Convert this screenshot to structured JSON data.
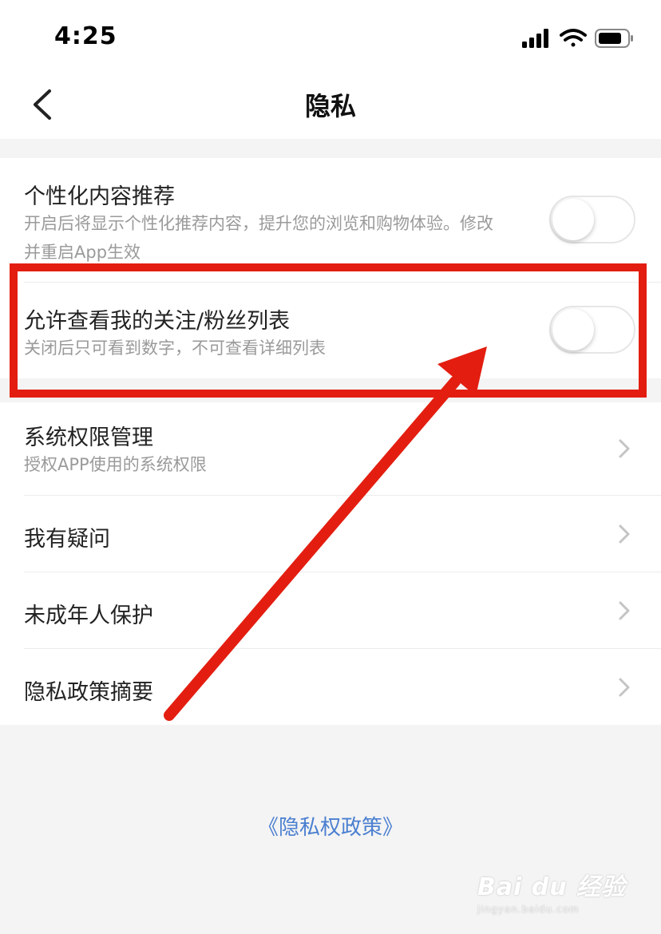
{
  "status_bar": {
    "time": "4:25"
  },
  "nav": {
    "title": "隐私"
  },
  "settings": {
    "personalized": {
      "title": "个性化内容推荐",
      "subtitle": "开启后将显示个性化推荐内容，提升您的浏览和购物体验。修改并重启App生效",
      "enabled": false
    },
    "follow_list": {
      "title": "允许查看我的关注/粉丝列表",
      "subtitle": "关闭后只可看到数字，不可查看详细列表",
      "enabled": false
    }
  },
  "menu": {
    "system_permissions": {
      "title": "系统权限管理",
      "subtitle": "授权APP使用的系统权限"
    },
    "questions": {
      "title": "我有疑问"
    },
    "minor_protection": {
      "title": "未成年人保护"
    },
    "privacy_summary": {
      "title": "隐私政策摘要"
    }
  },
  "footer": {
    "policy_link": "《隐私权政策》"
  },
  "watermark": {
    "main": "Bai du 经验",
    "sub": "jingyan.baidu.com"
  },
  "colors": {
    "annotation": "#e31e10",
    "link": "#4a7fd0"
  }
}
